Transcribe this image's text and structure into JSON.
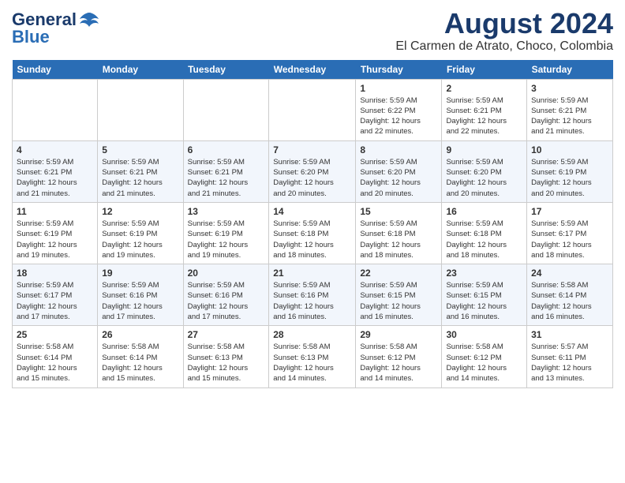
{
  "header": {
    "logo_general": "General",
    "logo_blue": "Blue",
    "month_title": "August 2024",
    "location": "El Carmen de Atrato, Choco, Colombia"
  },
  "weekdays": [
    "Sunday",
    "Monday",
    "Tuesday",
    "Wednesday",
    "Thursday",
    "Friday",
    "Saturday"
  ],
  "weeks": [
    [
      {
        "day": "",
        "info": ""
      },
      {
        "day": "",
        "info": ""
      },
      {
        "day": "",
        "info": ""
      },
      {
        "day": "",
        "info": ""
      },
      {
        "day": "1",
        "info": "Sunrise: 5:59 AM\nSunset: 6:22 PM\nDaylight: 12 hours\nand 22 minutes."
      },
      {
        "day": "2",
        "info": "Sunrise: 5:59 AM\nSunset: 6:21 PM\nDaylight: 12 hours\nand 22 minutes."
      },
      {
        "day": "3",
        "info": "Sunrise: 5:59 AM\nSunset: 6:21 PM\nDaylight: 12 hours\nand 21 minutes."
      }
    ],
    [
      {
        "day": "4",
        "info": "Sunrise: 5:59 AM\nSunset: 6:21 PM\nDaylight: 12 hours\nand 21 minutes."
      },
      {
        "day": "5",
        "info": "Sunrise: 5:59 AM\nSunset: 6:21 PM\nDaylight: 12 hours\nand 21 minutes."
      },
      {
        "day": "6",
        "info": "Sunrise: 5:59 AM\nSunset: 6:21 PM\nDaylight: 12 hours\nand 21 minutes."
      },
      {
        "day": "7",
        "info": "Sunrise: 5:59 AM\nSunset: 6:20 PM\nDaylight: 12 hours\nand 20 minutes."
      },
      {
        "day": "8",
        "info": "Sunrise: 5:59 AM\nSunset: 6:20 PM\nDaylight: 12 hours\nand 20 minutes."
      },
      {
        "day": "9",
        "info": "Sunrise: 5:59 AM\nSunset: 6:20 PM\nDaylight: 12 hours\nand 20 minutes."
      },
      {
        "day": "10",
        "info": "Sunrise: 5:59 AM\nSunset: 6:19 PM\nDaylight: 12 hours\nand 20 minutes."
      }
    ],
    [
      {
        "day": "11",
        "info": "Sunrise: 5:59 AM\nSunset: 6:19 PM\nDaylight: 12 hours\nand 19 minutes."
      },
      {
        "day": "12",
        "info": "Sunrise: 5:59 AM\nSunset: 6:19 PM\nDaylight: 12 hours\nand 19 minutes."
      },
      {
        "day": "13",
        "info": "Sunrise: 5:59 AM\nSunset: 6:19 PM\nDaylight: 12 hours\nand 19 minutes."
      },
      {
        "day": "14",
        "info": "Sunrise: 5:59 AM\nSunset: 6:18 PM\nDaylight: 12 hours\nand 18 minutes."
      },
      {
        "day": "15",
        "info": "Sunrise: 5:59 AM\nSunset: 6:18 PM\nDaylight: 12 hours\nand 18 minutes."
      },
      {
        "day": "16",
        "info": "Sunrise: 5:59 AM\nSunset: 6:18 PM\nDaylight: 12 hours\nand 18 minutes."
      },
      {
        "day": "17",
        "info": "Sunrise: 5:59 AM\nSunset: 6:17 PM\nDaylight: 12 hours\nand 18 minutes."
      }
    ],
    [
      {
        "day": "18",
        "info": "Sunrise: 5:59 AM\nSunset: 6:17 PM\nDaylight: 12 hours\nand 17 minutes."
      },
      {
        "day": "19",
        "info": "Sunrise: 5:59 AM\nSunset: 6:16 PM\nDaylight: 12 hours\nand 17 minutes."
      },
      {
        "day": "20",
        "info": "Sunrise: 5:59 AM\nSunset: 6:16 PM\nDaylight: 12 hours\nand 17 minutes."
      },
      {
        "day": "21",
        "info": "Sunrise: 5:59 AM\nSunset: 6:16 PM\nDaylight: 12 hours\nand 16 minutes."
      },
      {
        "day": "22",
        "info": "Sunrise: 5:59 AM\nSunset: 6:15 PM\nDaylight: 12 hours\nand 16 minutes."
      },
      {
        "day": "23",
        "info": "Sunrise: 5:59 AM\nSunset: 6:15 PM\nDaylight: 12 hours\nand 16 minutes."
      },
      {
        "day": "24",
        "info": "Sunrise: 5:58 AM\nSunset: 6:14 PM\nDaylight: 12 hours\nand 16 minutes."
      }
    ],
    [
      {
        "day": "25",
        "info": "Sunrise: 5:58 AM\nSunset: 6:14 PM\nDaylight: 12 hours\nand 15 minutes."
      },
      {
        "day": "26",
        "info": "Sunrise: 5:58 AM\nSunset: 6:14 PM\nDaylight: 12 hours\nand 15 minutes."
      },
      {
        "day": "27",
        "info": "Sunrise: 5:58 AM\nSunset: 6:13 PM\nDaylight: 12 hours\nand 15 minutes."
      },
      {
        "day": "28",
        "info": "Sunrise: 5:58 AM\nSunset: 6:13 PM\nDaylight: 12 hours\nand 14 minutes."
      },
      {
        "day": "29",
        "info": "Sunrise: 5:58 AM\nSunset: 6:12 PM\nDaylight: 12 hours\nand 14 minutes."
      },
      {
        "day": "30",
        "info": "Sunrise: 5:58 AM\nSunset: 6:12 PM\nDaylight: 12 hours\nand 14 minutes."
      },
      {
        "day": "31",
        "info": "Sunrise: 5:57 AM\nSunset: 6:11 PM\nDaylight: 12 hours\nand 13 minutes."
      }
    ]
  ]
}
